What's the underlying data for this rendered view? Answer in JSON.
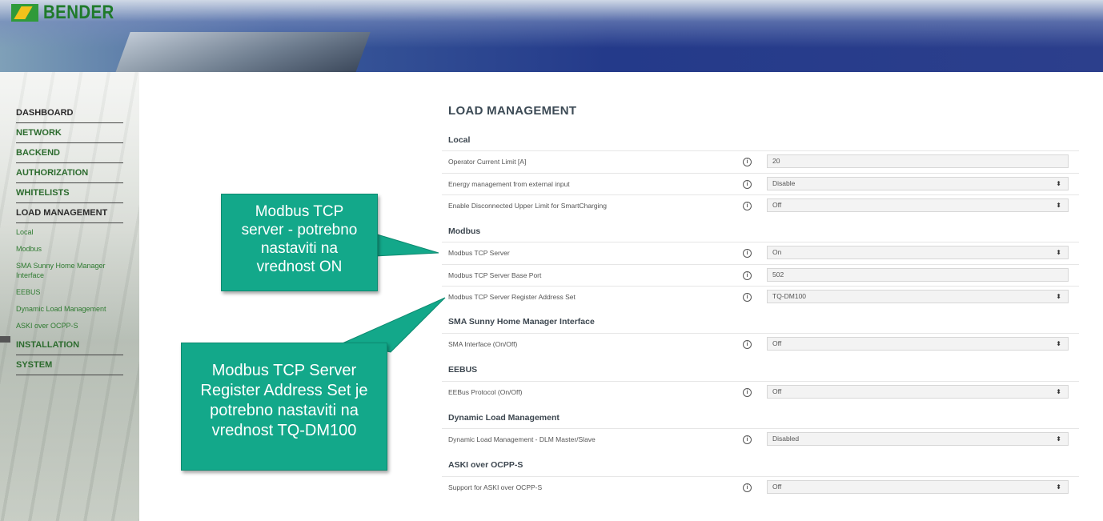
{
  "brand": {
    "name": "BENDER"
  },
  "sidebar": {
    "items": [
      {
        "label": "DASHBOARD",
        "type": "main",
        "style": "dark"
      },
      {
        "label": "NETWORK",
        "type": "main"
      },
      {
        "label": "BACKEND",
        "type": "main"
      },
      {
        "label": "AUTHORIZATION",
        "type": "main"
      },
      {
        "label": "WHITELISTS",
        "type": "main"
      },
      {
        "label": "LOAD MANAGEMENT",
        "type": "main",
        "style": "dark"
      },
      {
        "label": "Local",
        "type": "sub"
      },
      {
        "label": "Modbus",
        "type": "sub"
      },
      {
        "label": "SMA Sunny Home Manager Interface",
        "type": "sub"
      },
      {
        "label": "EEBUS",
        "type": "sub"
      },
      {
        "label": "Dynamic Load Management",
        "type": "sub"
      },
      {
        "label": "ASKI over OCPP-S",
        "type": "sub"
      },
      {
        "label": "INSTALLATION",
        "type": "main"
      },
      {
        "label": "SYSTEM",
        "type": "main"
      }
    ]
  },
  "main": {
    "title": "LOAD MANAGEMENT",
    "sections": [
      {
        "title": "Local"
      },
      {
        "title": "Modbus"
      },
      {
        "title": "SMA Sunny Home Manager Interface"
      },
      {
        "title": "EEBUS"
      },
      {
        "title": "Dynamic Load Management"
      },
      {
        "title": "ASKI over OCPP-S"
      }
    ],
    "rows": [
      {
        "label": "Operator Current Limit [A]",
        "value": "20",
        "control": "input"
      },
      {
        "label": "Energy management from external input",
        "value": "Disable",
        "control": "select"
      },
      {
        "label": "Enable Disconnected Upper Limit for SmartCharging",
        "value": "Off",
        "control": "select"
      },
      {
        "label": "Modbus TCP Server",
        "value": "On",
        "control": "select"
      },
      {
        "label": "Modbus TCP Server Base Port",
        "value": "502",
        "control": "input"
      },
      {
        "label": "Modbus TCP Server Register Address Set",
        "value": "TQ-DM100",
        "control": "select"
      },
      {
        "label": "SMA Interface (On/Off)",
        "value": "Off",
        "control": "select"
      },
      {
        "label": "EEBus Protocol (On/Off)",
        "value": "Off",
        "control": "select"
      },
      {
        "label": "Dynamic Load Management - DLM Master/Slave",
        "value": "Disabled",
        "control": "select"
      },
      {
        "label": "Support for ASKI over OCPP-S",
        "value": "Off",
        "control": "select"
      }
    ],
    "info_glyph": "i",
    "select_arrow": "⬍"
  },
  "callouts": [
    {
      "lines": [
        "Modbus TCP",
        "server - potrebno",
        "nastaviti na",
        "vrednost ON"
      ]
    },
    {
      "lines": [
        "Modbus TCP Server",
        "Register Address Set je",
        "potrebno nastaviti na",
        "vrednost TQ-DM100"
      ]
    }
  ],
  "colors": {
    "accent_green": "#2c6b2e",
    "callout": "#13a88a",
    "header_blue": "#243a8a"
  }
}
